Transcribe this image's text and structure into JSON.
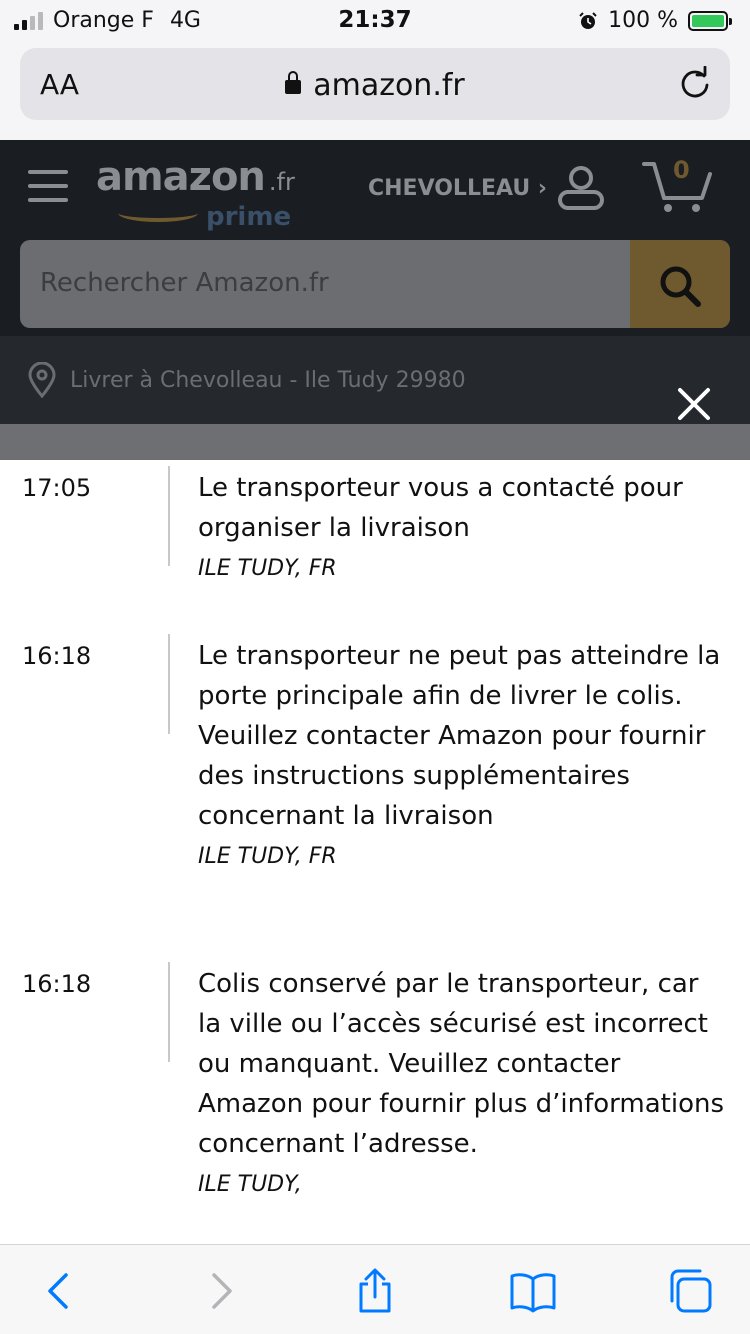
{
  "status_bar": {
    "carrier": "Orange F",
    "network": "4G",
    "time": "21:37",
    "battery": "100 %"
  },
  "browser": {
    "text_size_label": "AA",
    "url": "amazon.fr"
  },
  "amazon_header": {
    "logo_word": "amazon",
    "logo_tld": ".fr",
    "logo_prime": "prime",
    "account_label": "CHEVOLLEAU ›",
    "cart_count": "0",
    "search_placeholder": "Rechercher Amazon.fr",
    "deliver_to": "Livrer à Chevolleau - Ile Tudy 29980"
  },
  "tracking_events": [
    {
      "time": "17:05",
      "description": "Le transporteur vous a contacté pour organiser la livraison",
      "location": "ILE TUDY, FR"
    },
    {
      "time": "16:18",
      "description": "Le transporteur ne peut pas atteindre la porte principale afin de livrer le colis. Veuillez contacter Amazon pour fournir des instructions supplémentaires concernant la livraison",
      "location": "ILE TUDY, FR"
    },
    {
      "time": "16:18",
      "description": "Colis conservé par le transporteur, car la ville ou l’accès sécurisé est incorrect ou manquant. Veuillez contacter Amazon pour fournir plus d’informations concernant l’adresse.",
      "location": "ILE TUDY,"
    }
  ],
  "colors": {
    "ios_blue": "#007aff",
    "amazon_dark": "#1a1d22",
    "battery_green": "#34c759"
  },
  "icons": [
    "signal-icon",
    "alarm-icon",
    "battery-icon",
    "lock-icon",
    "reload-icon",
    "menu-icon",
    "user-icon",
    "cart-icon",
    "search-icon",
    "location-pin-icon",
    "close-icon",
    "back-icon",
    "forward-icon",
    "share-icon",
    "bookmarks-icon",
    "tabs-icon"
  ]
}
